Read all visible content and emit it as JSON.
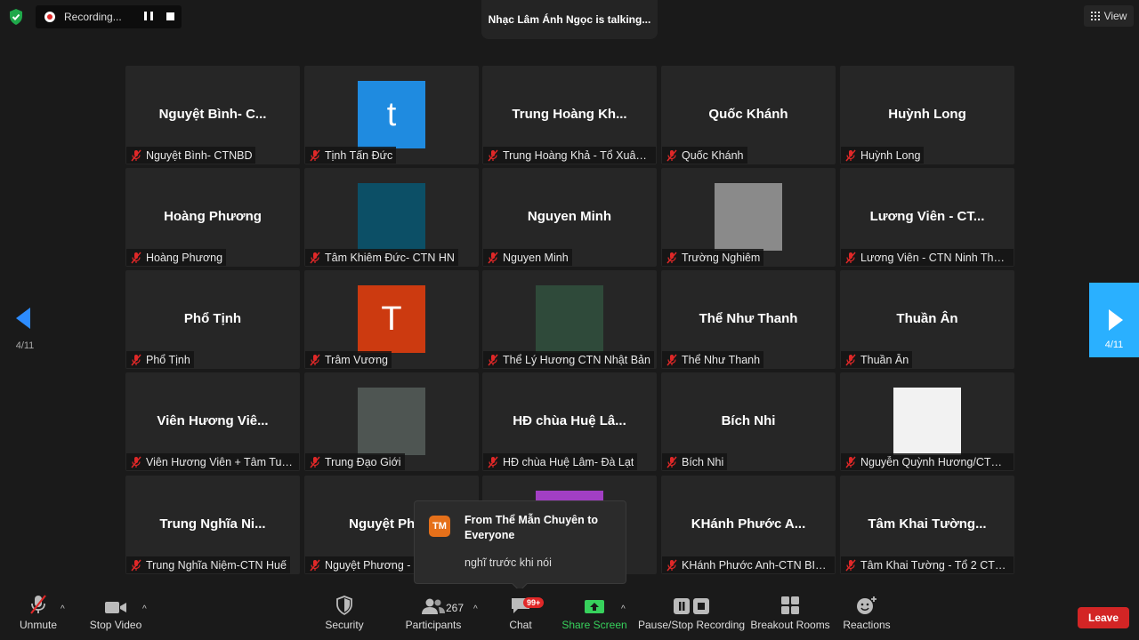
{
  "recording": {
    "label": "Recording..."
  },
  "talking_indicator": "Nhạc Lâm Ánh Ngọc is talking...",
  "view_button": {
    "label": "View"
  },
  "pagination": {
    "left": "4/11",
    "right": "4/11"
  },
  "participants_grid": [
    {
      "display": "Nguyệt  Bình- C...",
      "caption": "Nguyệt Bình- CTNBD"
    },
    {
      "display": "t",
      "caption": "Tịnh Tấn Đức",
      "avatar_color": "#1f8be0"
    },
    {
      "display": "Trung  Hoàng  Kh...",
      "caption": "Trung Hoàng Khả - Tổ Xuân ..."
    },
    {
      "display": "Quốc Khánh",
      "caption": "Quốc Khánh"
    },
    {
      "display": "Huỳnh Long",
      "caption": "Huỳnh Long"
    },
    {
      "display": "Hoàng Phương",
      "caption": "Hoàng Phương"
    },
    {
      "display": "",
      "caption": "Tâm Khiêm Đức- CTN HN",
      "avatar_color": "#0c4f66"
    },
    {
      "display": "Nguyen Minh",
      "caption": "Nguyen Minh"
    },
    {
      "display": "",
      "caption": "Trường Nghiêm",
      "avatar_color": "#8a8a8a"
    },
    {
      "display": "Lương Viên  - CT...",
      "caption": "Lương Viên - CTN Ninh Thuận"
    },
    {
      "display": "Phổ Tịnh",
      "caption": "Phổ Tịnh"
    },
    {
      "display": "T",
      "caption": "Trâm Vương",
      "avatar_color": "#cc3a10"
    },
    {
      "display": "",
      "caption": "Thể Lý Hương CTN Nhật Bản",
      "avatar_color": "#2f4a3a"
    },
    {
      "display": "Thể Như Thanh",
      "caption": "Thể Như Thanh"
    },
    {
      "display": "Thuần Ân",
      "caption": "Thuần Ân"
    },
    {
      "display": "Viên  Hương  Viê...",
      "caption": "Viên Hương Viên + Tâm Tuệ ..."
    },
    {
      "display": "",
      "caption": "Trung Đạo Giới",
      "avatar_color": "#4e5552"
    },
    {
      "display": "HĐ  chùa  Huệ  Lâ...",
      "caption": "HĐ chùa Huệ Lâm- Đà Lạt"
    },
    {
      "display": "Bích Nhi",
      "caption": "Bích Nhi"
    },
    {
      "display": "",
      "caption": "Nguyễn Quỳnh Hương/CTN P...",
      "avatar_color": "#f2f2f2"
    },
    {
      "display": "Trung  Nghĩa  Ni...",
      "caption": "Trung Nghĩa Niệm-CTN Huế"
    },
    {
      "display": "Nguyệt  Phươ",
      "caption": "Nguyệt Phương - C"
    },
    {
      "display": "",
      "caption": "",
      "avatar_color": "#a23fc4"
    },
    {
      "display": "KHánh  Phước  A...",
      "caption": "KHánh Phước Anh-CTN BIÊN ..."
    },
    {
      "display": "Tâm  Khai  Tường...",
      "caption": "Tâm Khai Tường - Tổ 2 CTN ..."
    }
  ],
  "chat_popup": {
    "avatar_initials": "TM",
    "from": "From Thể Mẫn Chuyên to Everyone",
    "message": "nghĩ trước khi nói"
  },
  "toolbar": {
    "unmute": "Unmute",
    "stop_video": "Stop Video",
    "security": "Security",
    "participants": "Participants",
    "participants_count": "267",
    "chat": "Chat",
    "chat_badge": "99+",
    "share_screen": "Share Screen",
    "recording": "Pause/Stop Recording",
    "breakout_rooms": "Breakout Rooms",
    "reactions": "Reactions",
    "leave": "Leave"
  },
  "colors": {
    "accent_blue": "#2ab0ff",
    "share_green": "#37d15c",
    "leave_red": "#d32525",
    "mute_red": "#e02828"
  }
}
